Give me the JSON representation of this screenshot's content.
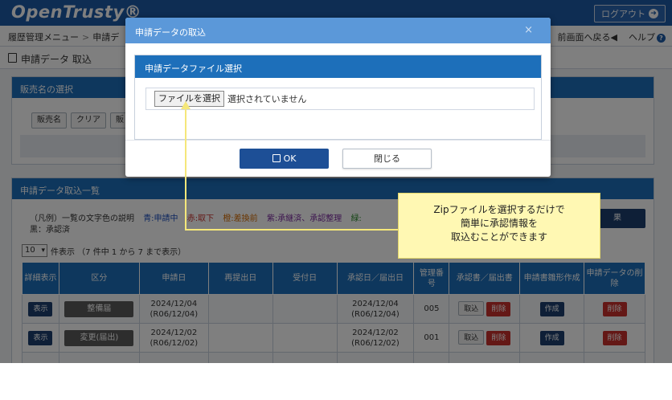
{
  "header": {
    "logo": "OpenTrusty®",
    "logout_label": "ログアウト"
  },
  "nav": {
    "breadcrumb_1": "履歴管理メニュー",
    "breadcrumb_sep": ">",
    "breadcrumb_2": "申請デ",
    "back_label": "前画面へ戻る",
    "help_label": "ヘルプ"
  },
  "page": {
    "title": "申請データ 取込"
  },
  "seller_panel": {
    "title": "販売名の選択",
    "buttons": [
      "販売名",
      "クリア",
      "販"
    ]
  },
  "list_panel": {
    "title": "申請データ取込一覧",
    "legend_prefix": "（凡例）一覧の文字色の説明",
    "legend_items": [
      {
        "text": "青:申請中",
        "color": "#1d4fbf"
      },
      {
        "text": "赤:取下",
        "color": "#c9302c"
      },
      {
        "text": "橙:差換前",
        "color": "#d46b00"
      },
      {
        "text": "紫:承継済、承認整理",
        "color": "#7a2b9e"
      },
      {
        "text": "緑:",
        "color": "#2a8a2a"
      }
    ],
    "legend_line2": "黒：承認済",
    "dark_button_label": "果",
    "page_size": "10",
    "paging_text": "件表示 （7 件中 1 から 7 まで表示）",
    "columns": [
      "詳細表示",
      "区分",
      "申請日",
      "再提出日",
      "受付日",
      "承認日／届出日",
      "管理番号",
      "承認書／届出書",
      "申請書雛形作成",
      "申請データの削除"
    ],
    "rows": [
      {
        "detail": "表示",
        "kubun": "整備届",
        "apply_date": "2024/12/04",
        "apply_date_jp": "(R06/12/04)",
        "resubmit": "",
        "accept": "",
        "approve_date": "2024/12/04",
        "approve_date_jp": "(R06/12/04)",
        "mgmt_no": "005",
        "import_label": "取込",
        "delete_label": "削除",
        "create_label": "作成",
        "del_data_label": "削除"
      },
      {
        "detail": "表示",
        "kubun": "変更(届出)",
        "apply_date": "2024/12/02",
        "apply_date_jp": "(R06/12/02)",
        "resubmit": "",
        "accept": "",
        "approve_date": "2024/12/02",
        "approve_date_jp": "(R06/12/02)",
        "mgmt_no": "001",
        "import_label": "取込",
        "delete_label": "削除",
        "create_label": "作成",
        "del_data_label": "削除"
      }
    ]
  },
  "modal": {
    "title": "申請データの取込",
    "close_glyph": "×",
    "section_title": "申請データファイル選択",
    "file_button_label": "ファイルを選択",
    "file_status": "選択されていません",
    "ok_label": "OK",
    "close_label": "閉じる"
  },
  "callout": {
    "line1": "Zipファイルを選択するだけで",
    "line2": "簡単に承認情報を",
    "line3": "取込むことができます"
  }
}
